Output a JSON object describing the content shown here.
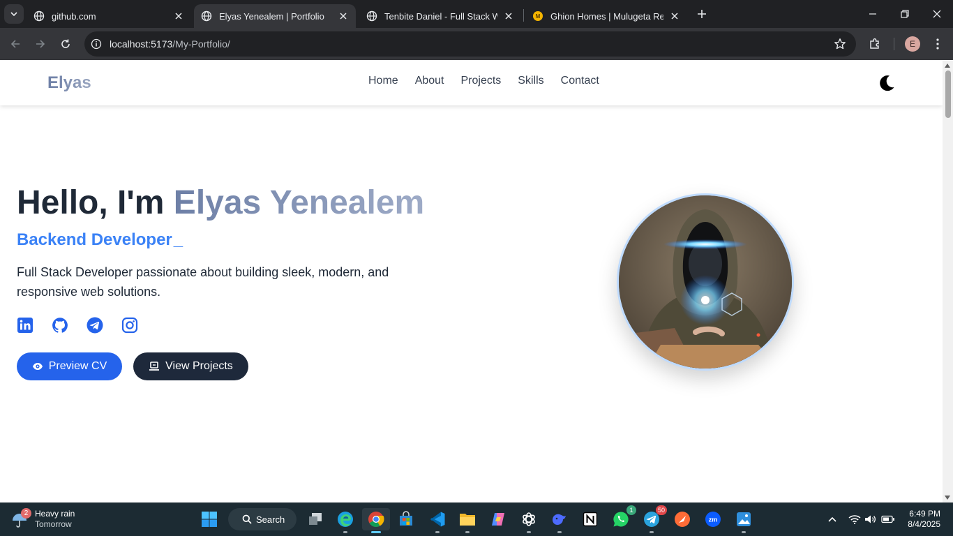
{
  "browser": {
    "tabs": [
      {
        "title": "github.com",
        "active": false
      },
      {
        "title": "Elyas Yenealem | Portfolio",
        "active": true
      },
      {
        "title": "Tenbite Daniel - Full Stack Web",
        "active": false
      },
      {
        "title": "Ghion Homes | Mulugeta Real E",
        "active": false
      }
    ],
    "url_host": "localhost:5173",
    "url_path": "/My-Portfolio/",
    "profile_initial": "E"
  },
  "site": {
    "brand": "Elyas",
    "nav": [
      "Home",
      "About",
      "Projects",
      "Skills",
      "Contact"
    ],
    "hero": {
      "greeting": "Hello, I'm ",
      "name": "Elyas Yenealem",
      "role": "Backend Developer",
      "cursor": "_",
      "description": "Full Stack Developer passionate about building sleek, modern, and responsive web solutions.",
      "buttons": {
        "cv": "Preview CV",
        "projects": "View Projects"
      },
      "socials": [
        "linkedin-icon",
        "github-icon",
        "telegram-icon",
        "instagram-icon"
      ]
    },
    "colors": {
      "accent": "#2563eb",
      "role_text": "#3b82f6",
      "dark_button": "#1e293b",
      "heading": "#1f2937"
    }
  },
  "taskbar": {
    "weather": {
      "badge": "2",
      "title": "Heavy rain",
      "subtitle": "Tomorrow"
    },
    "search_label": "Search",
    "badges": {
      "whatsapp": "1",
      "telegram": "50"
    },
    "time": "6:49 PM",
    "date": "8/4/2025"
  }
}
